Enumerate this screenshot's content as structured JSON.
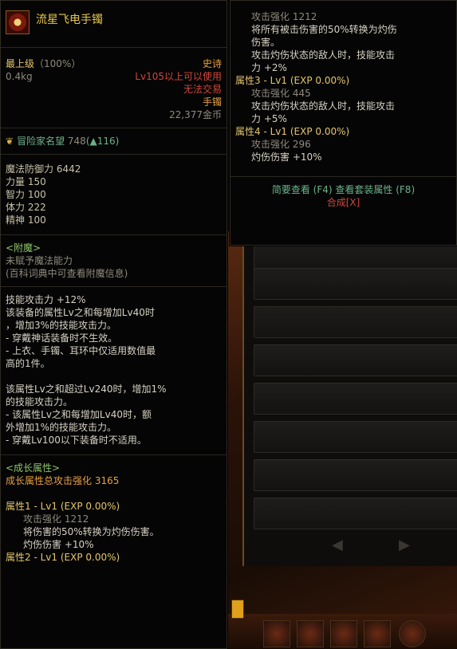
{
  "item": {
    "name": "流星飞电手镯",
    "grade": "最上级",
    "grade_pct": "（100%）",
    "rarity": "史诗",
    "weight": "0.4kg",
    "level_req": "Lv105以上可以使用",
    "trade": "无法交易",
    "slot": "手镯",
    "price": "22,377金币"
  },
  "fame": {
    "label": "冒险家名望",
    "value": "748",
    "delta": "(▲116)"
  },
  "stats": [
    {
      "name": "魔法防御力",
      "value": "6442"
    },
    {
      "name": "力量",
      "value": "150"
    },
    {
      "name": "智力",
      "value": "100"
    },
    {
      "name": "体力",
      "value": "222"
    },
    {
      "name": "精神",
      "value": "100"
    }
  ],
  "enchant": {
    "title": "<附魔>",
    "line1": "未赋予魔法能力",
    "line2": "(百科词典中可查看附魔信息)"
  },
  "skill_text": {
    "p1": [
      "技能攻击力 +12%",
      "该装备的属性Lv之和每增加Lv40时",
      "，增加3%的技能攻击力。",
      "- 穿戴神话装备时不生效。",
      "- 上衣、手镯、耳环中仅适用数值最",
      "高的1件。"
    ],
    "p2": [
      "该属性Lv之和超过Lv240时，增加1%",
      "的技能攻击力。",
      "- 该属性Lv之和每增加Lv40时，额",
      "外增加1%的技能攻击力。",
      "- 穿戴Lv100以下装备时不适用。"
    ]
  },
  "growth": {
    "title": "<成长属性>",
    "total_label": "成长属性总攻击强化",
    "total_value": "3165",
    "attr1_title": "属性1 - Lv1 (EXP 0.00%)",
    "attr1_lines": [
      "攻击强化  1212",
      "将伤害的50%转换为灼伤伤害。",
      "灼伤伤害  +10%"
    ],
    "attr2_title": "属性2 - Lv1 (EXP 0.00%)"
  },
  "right": {
    "lines_top": [
      "攻击强化  1212",
      "将所有被击伤害的50%转换为灼伤",
      "伤害。",
      "攻击灼伤状态的敌人时，技能攻击",
      "力 +2%"
    ],
    "attr3_title": "属性3 - Lv1 (EXP 0.00%)",
    "attr3_lines": [
      "攻击强化  445",
      "攻击灼伤状态的敌人时，技能攻击",
      "力 +5%"
    ],
    "attr4_title": "属性4 - Lv1 (EXP 0.00%)",
    "attr4_lines": [
      "攻击强化  296",
      "灼伤伤害  +10%"
    ],
    "btn_brief": "简要查看 (F4)",
    "btn_set": "查看套装属性 (F8)",
    "btn_compose": "合成[X]"
  },
  "colors": {
    "title": "#e6c84a",
    "rarity": "#e8a142",
    "warn": "#d0473a",
    "section": "#8fc46b"
  }
}
